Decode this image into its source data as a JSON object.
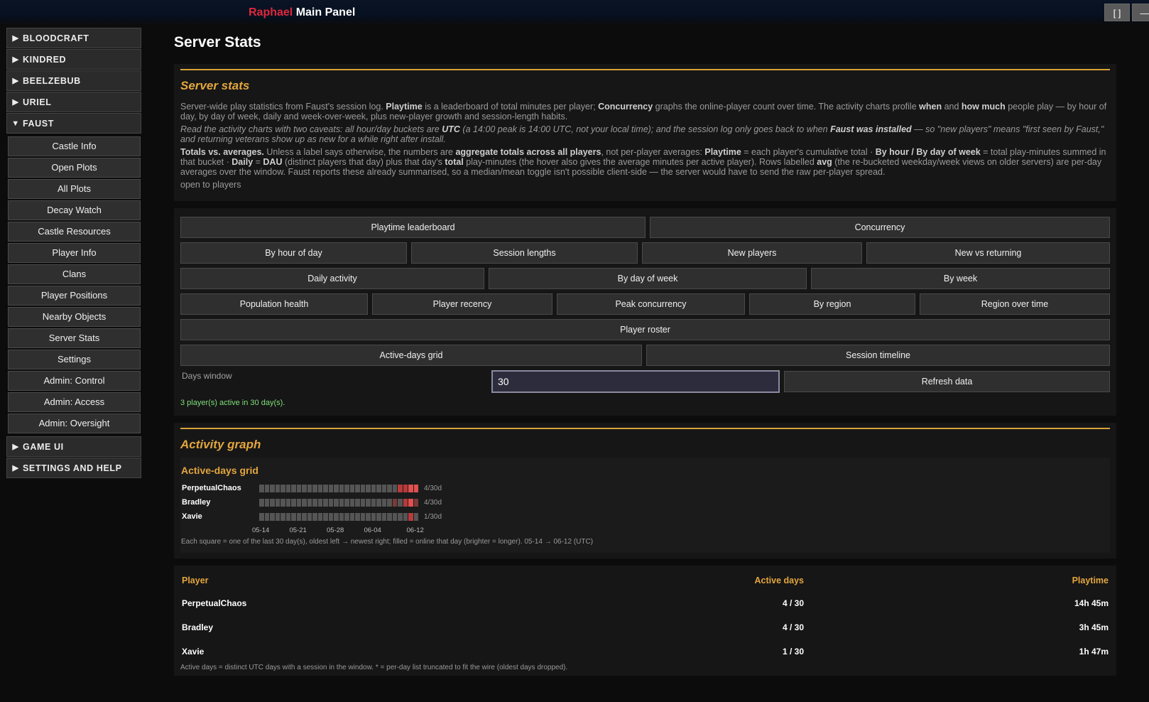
{
  "window": {
    "brand": "Raphael",
    "title": "Main Panel",
    "btn_restore": "[ ]",
    "btn_minimize": "—"
  },
  "sidebar": {
    "categories_top": [
      {
        "label": "BLOODCRAFT",
        "arrow": "▶"
      },
      {
        "label": "KINDRED",
        "arrow": "▶"
      },
      {
        "label": "BEELZEBUB",
        "arrow": "▶"
      },
      {
        "label": "URIEL",
        "arrow": "▶"
      },
      {
        "label": "FAUST",
        "arrow": "▼"
      }
    ],
    "faust_items": [
      "Castle Info",
      "Open Plots",
      "All Plots",
      "Decay Watch",
      "Castle Resources",
      "Player Info",
      "Clans",
      "Player Positions",
      "Nearby Objects",
      "Server Stats",
      "Settings",
      "Admin: Control",
      "Admin: Access",
      "Admin: Oversight"
    ],
    "categories_bottom": [
      {
        "label": "GAME UI",
        "arrow": "▶"
      },
      {
        "label": "SETTINGS AND HELP",
        "arrow": "▶"
      }
    ]
  },
  "main": {
    "page_title": "Server Stats",
    "stats_panel": {
      "heading": "Server stats",
      "p1": {
        "t1": "Server-wide play statistics from Faust's session log. ",
        "b1": "Playtime",
        "t2": " is a leaderboard of total minutes per player; ",
        "b2": "Concurrency",
        "t3": " graphs the online-player count over time. The activity charts profile ",
        "b3": "when",
        "t4": " and ",
        "b4": "how much",
        "t5": " people play — by hour of day, by day of week, daily and week-over-week, plus new-player growth and session-length habits."
      },
      "p2": {
        "t1": "Read the activity charts with two caveats: all hour/day buckets are ",
        "b1": "UTC",
        "t2": " (a 14:00 peak is 14:00 UTC, not your local time); and the session log only goes back to when ",
        "b2": "Faust was installed",
        "t3": " — so \"new players\" means \"first seen by Faust,\" and returning veterans show up as new for a while right after install."
      },
      "p3": {
        "b1": "Totals vs. averages.",
        "t1": " Unless a label says otherwise, the numbers are ",
        "b2": "aggregate totals across all players",
        "t2": ", not per-player averages: ",
        "b3": "Playtime",
        "t3": " = each player's cumulative total · ",
        "b4": "By hour / By day of week",
        "t4": " = total play-minutes summed in that bucket · ",
        "b5": "Daily",
        "t5": " = ",
        "b6": "DAU",
        "t6": " (distinct players that day) plus that day's ",
        "b7": "total",
        "t7": " play-minutes (the hover also gives the average minutes per active player). Rows labelled ",
        "b8": "avg",
        "t8": " (the re-bucketed weekday/week views on older servers) are per-day averages over the window. Faust reports these already summarised, so a median/mean toggle isn't possible client-side — the server would have to send the raw per-player spread."
      },
      "p4": "open to players",
      "buttons": {
        "row1": [
          "Playtime leaderboard",
          "Concurrency"
        ],
        "row2": [
          "By hour of day",
          "Session lengths",
          "New players",
          "New vs returning"
        ],
        "row3": [
          "Daily activity",
          "By day of week",
          "By week"
        ],
        "row4": [
          "Population health",
          "Player recency",
          "Peak concurrency",
          "By region",
          "Region over time"
        ],
        "row5": [
          "Player roster"
        ],
        "row6": [
          "Active-days grid",
          "Session timeline"
        ]
      },
      "days_window_label": "Days window",
      "days_window_value": "30",
      "refresh_label": "Refresh data",
      "status": "3 player(s) active in 30 day(s)."
    },
    "activity_panel": {
      "heading": "Activity graph",
      "grid": {
        "title": "Active-days grid",
        "rows": [
          {
            "name": "PerpetualChaos",
            "count": "4/30d",
            "days": [
              0,
              0,
              0,
              0,
              0,
              0,
              0,
              0,
              0,
              0,
              0,
              0,
              0,
              0,
              0,
              0,
              0,
              0,
              0,
              0,
              0,
              0,
              0,
              0,
              0,
              0,
              2,
              2,
              3,
              3
            ]
          },
          {
            "name": "Bradley",
            "count": "4/30d",
            "days": [
              0,
              0,
              0,
              0,
              0,
              0,
              0,
              0,
              0,
              0,
              0,
              0,
              0,
              0,
              0,
              0,
              0,
              0,
              0,
              0,
              0,
              0,
              0,
              0,
              0,
              1,
              0,
              2,
              3,
              1
            ]
          },
          {
            "name": "Xavie",
            "count": "1/30d",
            "days": [
              0,
              0,
              0,
              0,
              0,
              0,
              0,
              0,
              0,
              0,
              0,
              0,
              0,
              0,
              0,
              0,
              0,
              0,
              0,
              0,
              0,
              0,
              0,
              0,
              0,
              0,
              0,
              0,
              2,
              0
            ]
          }
        ],
        "ticks": [
          {
            "label": "05-14",
            "day": 0
          },
          {
            "label": "05-21",
            "day": 7
          },
          {
            "label": "05-28",
            "day": 14
          },
          {
            "label": "06-04",
            "day": 21
          },
          {
            "label": "06-12",
            "day": 29
          }
        ],
        "note": "Each square = one of the last 30 day(s), oldest left → newest right; filled = online that day (brighter = longer). 05-14 → 06-12 (UTC)"
      }
    },
    "table": {
      "headers": [
        "Player",
        "Active days",
        "Playtime"
      ],
      "rows": [
        [
          "PerpetualChaos",
          "4 / 30",
          "14h 45m"
        ],
        [
          "Bradley",
          "4 / 30",
          "3h 45m"
        ],
        [
          "Xavie",
          "1 / 30",
          "1h 47m"
        ]
      ],
      "note": "Active days = distinct UTC days with a session in the window. * = per-day list truncated to fit the wire (oldest days dropped)."
    },
    "colors": {
      "accent": "#e3a63e",
      "brand_red": "#e0283a",
      "status_green": "#7fe07a",
      "cell_empty": "#555555",
      "cell_levels": [
        "#555555",
        "#7a3a3a",
        "#b83a3a",
        "#e05050"
      ]
    }
  }
}
